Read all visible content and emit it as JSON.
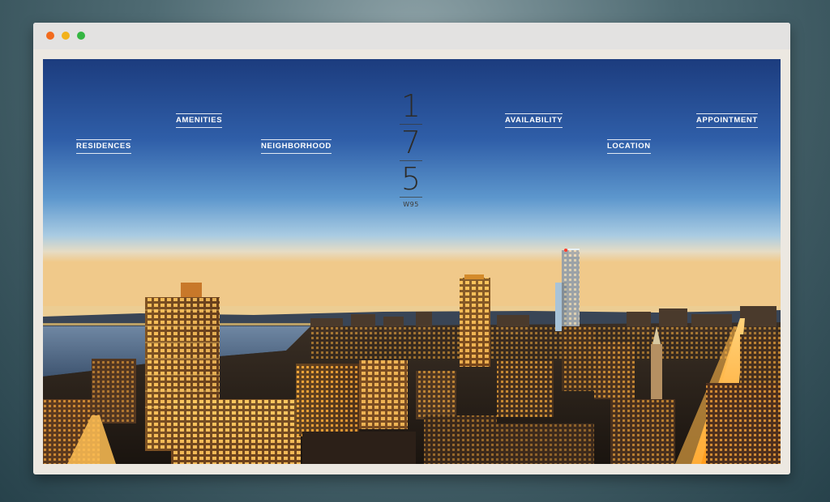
{
  "window": {
    "controls": [
      "close",
      "minimize",
      "maximize"
    ]
  },
  "nav": {
    "residences": "RESIDENCES",
    "amenities": "AMENITIES",
    "neighborhood": "NEIGHBORHOOD",
    "availability": "AVAILABILITY",
    "location": "LOCATION",
    "appointment": "APPOINTMENT"
  },
  "logo": {
    "digit1": "1",
    "digit2": "7",
    "digit3": "5",
    "subtitle": "W95"
  },
  "colors": {
    "close": "#f26b1d",
    "minimize": "#f2b21b",
    "maximize": "#35b642",
    "sky_top": "#1d3f84",
    "city_lights": "#f5a623"
  }
}
